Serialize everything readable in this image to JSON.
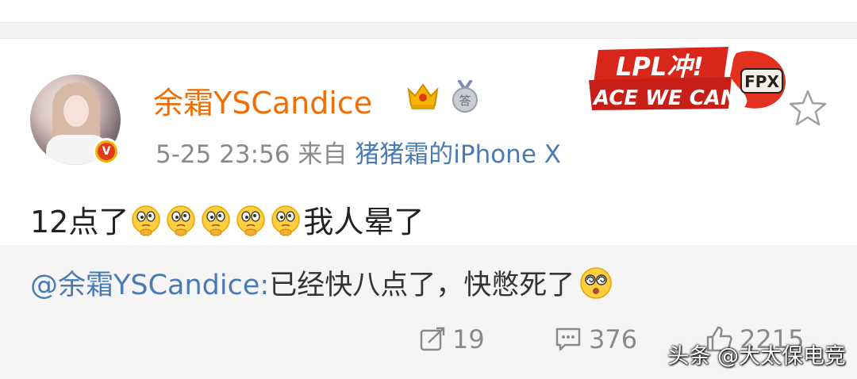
{
  "post": {
    "username": "余霜YSCandice",
    "timestamp": "5-25 23:56",
    "source_prefix": "来自",
    "source_device": "猪猪霜的iPhone X",
    "text_start": "12点了",
    "text_end": "我人晕了",
    "emoji_count": 5,
    "emoji_name": "dizzy-thinking-emoji"
  },
  "badges": {
    "verified": "V",
    "medal": "答",
    "banner_top": "LPL冲!",
    "banner_bottom": "ACE WE CAN",
    "banner_team": "FPX"
  },
  "retweet": {
    "mention": "@余霜YSCandice:",
    "text": " 已经快八点了，快憋死了"
  },
  "actions": {
    "repost_count": "19",
    "comment_count": "376",
    "like_count": "2215"
  },
  "watermark": "头条 @大太保电竞",
  "colors": {
    "username": "#f06e05",
    "link": "#4a7bb5",
    "meta": "#8a8a8a",
    "banner_red": "#d8261b"
  }
}
